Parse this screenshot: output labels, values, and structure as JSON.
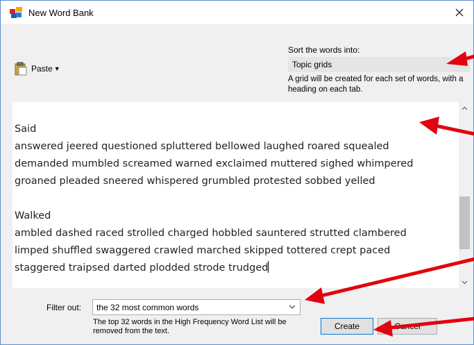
{
  "window": {
    "title": "New Word Bank",
    "close_icon": "close-icon"
  },
  "paste": {
    "label": "Paste",
    "icon": "clipboard-icon"
  },
  "sort": {
    "label": "Sort the words into:",
    "value": "Topic grids",
    "help": "A grid will be created for each set of words, with a heading on each tab."
  },
  "editor": {
    "lines": [
      "Said",
      "answered jeered questioned spluttered bellowed laughed roared squealed",
      "demanded mumbled screamed warned exclaimed muttered sighed whimpered",
      "groaned pleaded sneered whispered grumbled protested sobbed yelled",
      "",
      "Walked",
      "ambled dashed raced strolled charged hobbled sauntered strutted clambered",
      "limped shuffled swaggered crawled marched skipped tottered crept paced",
      "staggered traipsed darted plodded strode trudged"
    ]
  },
  "filter": {
    "label": "Filter out:",
    "value": "the 32 most common words",
    "help": "The top 32 words in the High Frequency Word List will be removed from the text."
  },
  "buttons": {
    "create": "Create",
    "cancel": "Cancel"
  },
  "colors": {
    "annotation_arrow": "#e3000f",
    "accent": "#0078d7"
  }
}
